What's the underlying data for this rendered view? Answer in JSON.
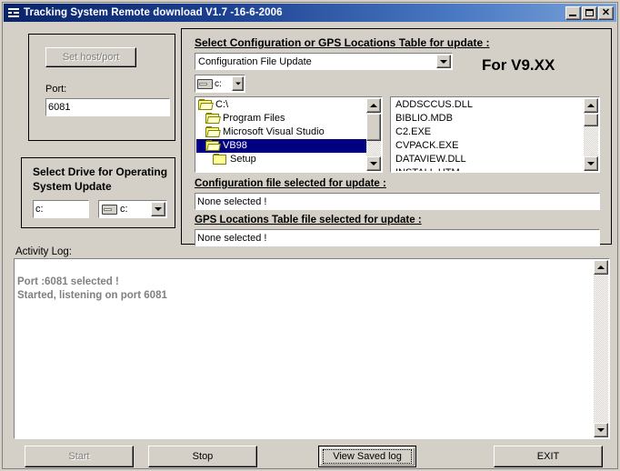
{
  "window": {
    "title": "Tracking System Remote download V1.7 -16-6-2006",
    "icon": "app-icon",
    "minimize_label": "_",
    "maximize_label": "□",
    "close_label": "✕",
    "titlebar_color": "#0a246a",
    "face_color": "#d4d0c8"
  },
  "host_panel": {
    "set_host_button": "Set host/port",
    "port_label": "Port:",
    "port_value": "6081"
  },
  "drive_panel": {
    "title_line1": "Select Drive for Operating",
    "title_line2": "System Update",
    "drive_text_value": "c:",
    "drive_combo_value": "c:"
  },
  "update_panel": {
    "header": "Select Configuration or GPS Locations Table for update :",
    "version_note": "For V9.XX",
    "mode_combo_value": "Configuration File Update",
    "drive_combo_value": "c:",
    "config_selected_label": "Configuration file selected for update :",
    "config_selected_value": "None selected !",
    "gps_selected_label": "GPS Locations Table file selected for update :",
    "gps_selected_value": "None selected !",
    "dir_tree": [
      {
        "label": "C:\\",
        "indent": 0,
        "icon": "folder-open-icon",
        "selected": false
      },
      {
        "label": "Program Files",
        "indent": 1,
        "icon": "folder-open-icon",
        "selected": false
      },
      {
        "label": "Microsoft Visual Studio",
        "indent": 1,
        "icon": "folder-open-icon",
        "selected": false
      },
      {
        "label": "VB98",
        "indent": 1,
        "icon": "folder-open-icon",
        "selected": true
      },
      {
        "label": "Setup",
        "indent": 2,
        "icon": "folder-closed-icon",
        "selected": false
      }
    ],
    "file_list": [
      "ADDSCCUS.DLL",
      "BIBLIO.MDB",
      "C2.EXE",
      "CVPACK.EXE",
      "DATAVIEW.DLL",
      "INSTALL.HTM"
    ]
  },
  "activity_log": {
    "label": "Activity Log:",
    "lines": "Port :6081 selected !\nStarted, listening on port 6081",
    "text_color": "#808080"
  },
  "footer": {
    "start_label": "Start",
    "stop_label": "Stop",
    "view_saved_log_label": "View Saved log",
    "exit_label": "EXIT"
  }
}
